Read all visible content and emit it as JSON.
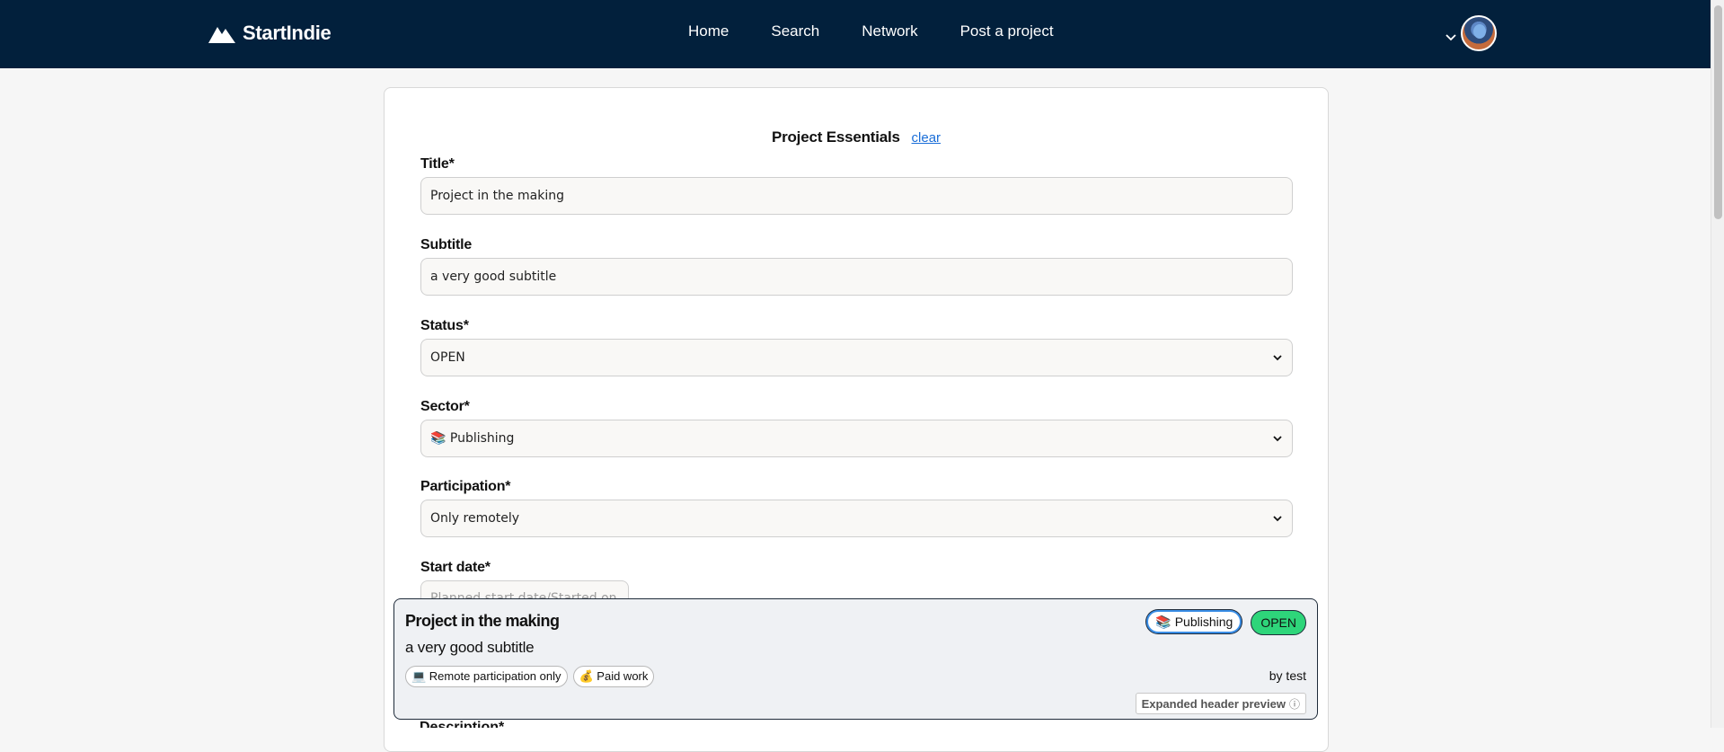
{
  "navbar": {
    "brand": "StartIndie",
    "links": [
      "Home",
      "Search",
      "Network",
      "Post a project"
    ],
    "accent": "#02203c"
  },
  "form": {
    "section_title": "Project Essentials",
    "clear_link": "clear",
    "title_label": "Title*",
    "title_value": "Project in the making",
    "subtitle_label": "Subtitle",
    "subtitle_value": "a very good subtitle",
    "status_label": "Status*",
    "status_value": "OPEN",
    "sector_label": "Sector*",
    "sector_value": "📚 Publishing",
    "participation_label": "Participation*",
    "participation_value": "Only remotely",
    "start_date_label": "Start date*",
    "start_date_placeholder": "Planned start date/Started on",
    "description_label": "Description*"
  },
  "preview": {
    "title": "Project in the making",
    "subtitle": "a very good subtitle",
    "sector_badge": "📚 Publishing",
    "status_badge": "OPEN",
    "tags": [
      "💻 Remote participation only",
      "💰 Paid work"
    ],
    "author": "by test",
    "note": "Expanded header preview",
    "note_icon": "ⓘ",
    "status_color": "#2ed57a"
  }
}
